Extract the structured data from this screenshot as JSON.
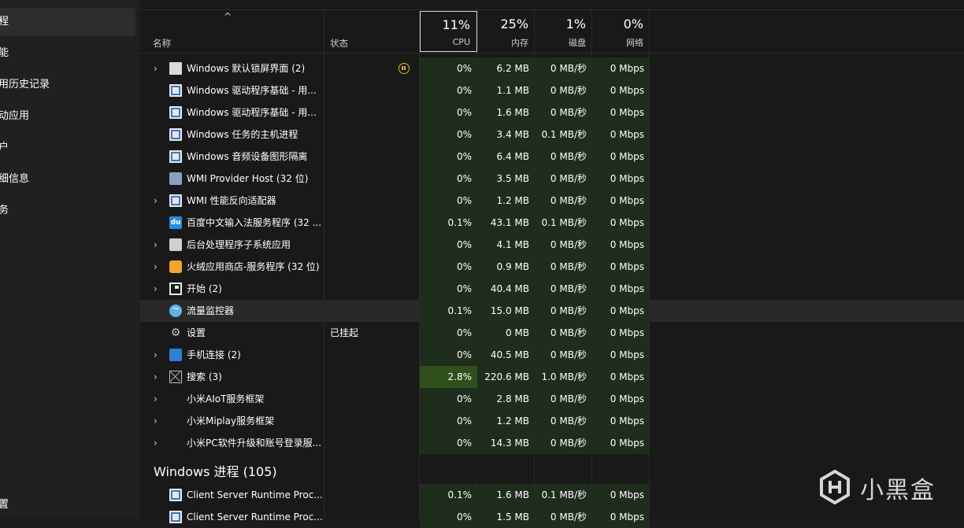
{
  "sidebar": {
    "items": [
      {
        "label": "程",
        "selected": true
      },
      {
        "label": "能"
      },
      {
        "label": "用历史记录"
      },
      {
        "label": "动应用"
      },
      {
        "label": "户"
      },
      {
        "label": "细信息"
      },
      {
        "label": "务"
      },
      {
        "label": "置"
      }
    ]
  },
  "header": {
    "name": "名称",
    "status": "状态",
    "cpu": {
      "pct": "11%",
      "label": "CPU"
    },
    "memory": {
      "pct": "25%",
      "label": "内存"
    },
    "disk": {
      "pct": "1%",
      "label": "磁盘"
    },
    "network": {
      "pct": "0%",
      "label": "网络"
    }
  },
  "rows": [
    {
      "name": "Windows 默认锁屏界面 (2)",
      "status": "",
      "cpu": "0%",
      "mem": "6.2 MB",
      "disk": "0 MB/秒",
      "net": "0 Mbps",
      "icon": "lockscreen-icon"
    },
    {
      "name": "Windows 驱动程序基础 - 用...",
      "status": "",
      "cpu": "0%",
      "mem": "1.1 MB",
      "disk": "0 MB/秒",
      "net": "0 Mbps",
      "icon": "window-app-icon"
    },
    {
      "name": "Windows 驱动程序基础 - 用...",
      "status": "",
      "cpu": "0%",
      "mem": "1.6 MB",
      "disk": "0 MB/秒",
      "net": "0 Mbps",
      "icon": "window-app-icon"
    },
    {
      "name": "Windows 任务的主机进程",
      "status": "",
      "cpu": "0%",
      "mem": "3.4 MB",
      "disk": "0.1 MB/秒",
      "net": "0 Mbps",
      "icon": "window-app-icon"
    },
    {
      "name": "Windows 音频设备图形隔离",
      "status": "",
      "cpu": "0%",
      "mem": "6.4 MB",
      "disk": "0 MB/秒",
      "net": "0 Mbps",
      "icon": "window-app-icon"
    },
    {
      "name": "WMI Provider Host (32 位)",
      "status": "",
      "cpu": "0%",
      "mem": "3.5 MB",
      "disk": "0 MB/秒",
      "net": "0 Mbps",
      "icon": "wmi-icon"
    },
    {
      "name": "WMI 性能反向适配器",
      "status": "",
      "cpu": "0%",
      "mem": "1.2 MB",
      "disk": "0 MB/秒",
      "net": "0 Mbps",
      "icon": "window-app-icon"
    },
    {
      "name": "百度中文输入法服务程序 (32 ...",
      "status": "",
      "cpu": "0.1%",
      "mem": "43.1 MB",
      "disk": "0.1 MB/秒",
      "net": "0 Mbps",
      "icon": "baidu-du-icon"
    },
    {
      "name": "后台处理程序子系统应用",
      "status": "",
      "cpu": "0%",
      "mem": "4.1 MB",
      "disk": "0 MB/秒",
      "net": "0 Mbps",
      "icon": "printer-icon"
    },
    {
      "name": "火绒应用商店-服务程序 (32 位)",
      "status": "",
      "cpu": "0%",
      "mem": "0.9 MB",
      "disk": "0 MB/秒",
      "net": "0 Mbps",
      "icon": "huorong-store-icon"
    },
    {
      "name": "开始 (2)",
      "status": "",
      "cpu": "0%",
      "mem": "40.4 MB",
      "disk": "0 MB/秒",
      "net": "0 Mbps",
      "icon": "start-icon"
    },
    {
      "name": "流量监控器",
      "status": "",
      "cpu": "0.1%",
      "mem": "15.0 MB",
      "disk": "0 MB/秒",
      "net": "0 Mbps",
      "icon": "traffic-monitor-icon"
    },
    {
      "name": "设置",
      "status": "已挂起",
      "cpu": "0%",
      "mem": "0 MB",
      "disk": "0 MB/秒",
      "net": "0 Mbps",
      "icon": "gear-icon"
    },
    {
      "name": "手机连接 (2)",
      "status": "",
      "cpu": "0%",
      "mem": "40.5 MB",
      "disk": "0 MB/秒",
      "net": "0 Mbps",
      "icon": "phone-link-icon"
    },
    {
      "name": "搜索 (3)",
      "status": "",
      "cpu": "2.8%",
      "mem": "220.6 MB",
      "disk": "1.0 MB/秒",
      "net": "0 Mbps",
      "icon": "search-app-icon"
    },
    {
      "name": "小米AIoT服务框架",
      "status": "",
      "cpu": "0%",
      "mem": "2.8 MB",
      "disk": "0 MB/秒",
      "net": "0 Mbps",
      "icon": "none"
    },
    {
      "name": "小米Miplay服务框架",
      "status": "",
      "cpu": "0%",
      "mem": "1.2 MB",
      "disk": "0 MB/秒",
      "net": "0 Mbps",
      "icon": "none"
    },
    {
      "name": "小米PC软件升级和账号登录服...",
      "status": "",
      "cpu": "0%",
      "mem": "14.3 MB",
      "disk": "0 MB/秒",
      "net": "0 Mbps",
      "icon": "none"
    }
  ],
  "group": {
    "title": "Windows 进程 (105)"
  },
  "group_rows": [
    {
      "name": "Client Server Runtime Proc...",
      "cpu": "0.1%",
      "mem": "1.6 MB",
      "disk": "0.1 MB/秒",
      "net": "0 Mbps"
    },
    {
      "name": "Client Server Runtime Proc...",
      "cpu": "0%",
      "mem": "1.5 MB",
      "disk": "0 MB/秒",
      "net": "0 Mbps"
    }
  ],
  "watermark": {
    "text": "小黑盒"
  }
}
